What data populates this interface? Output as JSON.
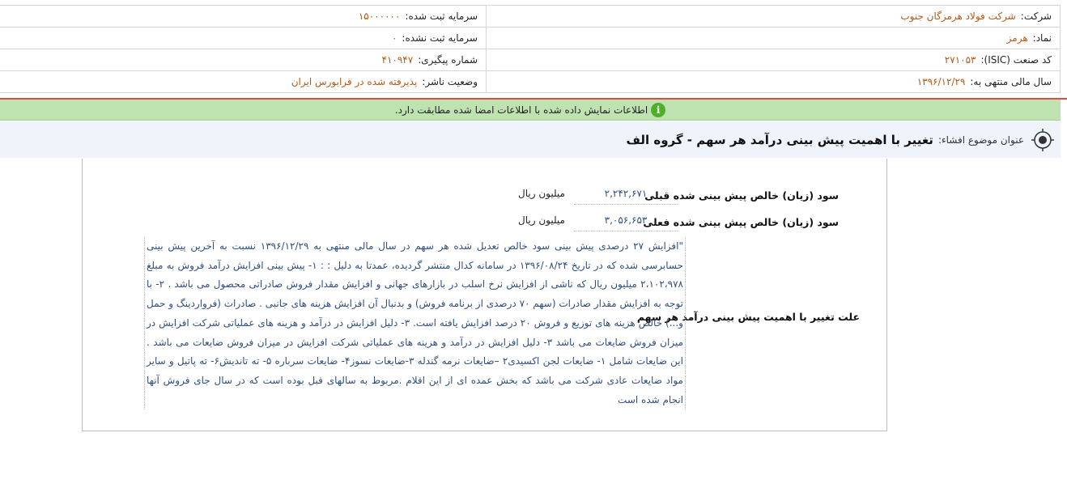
{
  "header": {
    "company_label": "شرکت:",
    "company_value": "شرکت فولاد هرمزگان جنوب",
    "reg_capital_label": "سرمایه ثبت شده:",
    "reg_capital_value": "۱۵۰۰۰۰۰۰",
    "symbol_label": "نماد:",
    "symbol_value": "هرمز",
    "unreg_capital_label": "سرمایه ثبت نشده:",
    "unreg_capital_value": "۰",
    "isic_label": "کد صنعت (ISIC):",
    "isic_value": "۲۷۱۰۵۳",
    "tracking_label": "شماره پیگیری:",
    "tracking_value": "۴۱۰۹۴۷",
    "fiscal_label": "سال مالی منتهی به:",
    "fiscal_value": "۱۳۹۶/۱۲/۲۹",
    "status_label": "وضعیت ناشر:",
    "status_value": "پذیرفته شده در فرابورس ایران"
  },
  "notice": {
    "icon": "info-icon",
    "text": "اطلاعات نمایش داده شده با اطلاعات امضا شده مطابقت دارد."
  },
  "subject": {
    "icon": "target-icon",
    "label": "عنوان موضوع افشاء:",
    "title": "تغییر با اهمیت پیش بینی درآمد هر سهم - گروه الف"
  },
  "fields": {
    "prev_label": "سود (زیان) خالص پیش بینی شده قبلی",
    "prev_value": "۲,۲۴۲,۶۷۱",
    "prev_unit": "میلیون ریال",
    "curr_label": "سود (زیان) خالص پیش بینی شده فعلی",
    "curr_value": "۳,۰۵۶,۶۵۳",
    "curr_unit": "میلیون ریال",
    "reason_label": "علت تغییر با اهمیت پیش بینی درآمد هر سهم",
    "reason_text": "\"افزایش ۲۷ درصدی پیش بینی سود خالص تعدیل شده هر سهم در سال مالی منتهی به ۱۳۹۶/۱۲/۲۹ نسبت به آخرین پیش بینی حسابرسی شده که در تاریخ ۱۳۹۶/۰۸/۲۴ در سامانه کدال منتشر گردیده، عمدتا به دلیل : : ۱- پیش بینی افزایش درآمد فروش به مبلغ ۲،۱۰۲،۹۷۸ میلیون ریال که ناشی از افزایش نرخ اسلب در بازارهای جهانی و افزایش مقدار فروش صادراتی محصول می باشد . ۲- با توجه به افزایش مقدار صادرات (سهم ۷۰ درصدی از برنامه فروش) و بدنبال آن افزایش هزینه های جانبی . صادرات (فرواردینگ و حمل و...) خالص هزینه های توزیع و فروش ۲۰ درصد افزایش یافته است. ۳- دلیل افزایش در درآمد و هزینه های عملیاتی شرکت افزایش در میزان فروش ضایعات می باشد ۳- دلیل افزایش در درآمد و هزینه های عملیاتی شرکت افزایش در میزان فروش ضایعات می باشد . این ضایعات شامل ۱- ضایعات لجن اکسیدی۲ –ضایعات نرمه گندله ۳-ضایعات نسوز۴- ضایعات سرباره ۵- ته تاندیش۶- ته پاتیل و سایر مواد ضایعات عادی شرکت می باشد که بخش عمده ای از این اقلام .مربوط به سالهای قبل بوده است که در سال جای فروش آنها انجام شده است"
  }
}
